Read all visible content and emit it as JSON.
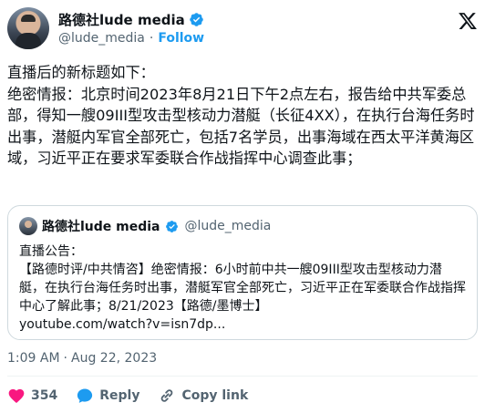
{
  "author": {
    "display_name": "路德社lude media",
    "handle": "@lude_media",
    "separator": "·",
    "follow_label": "Follow"
  },
  "tweet": {
    "text": "直播后的新标题如下：\n绝密情报：北京时间2023年8月21日下午2点左右，报告给中共军委总部，得知一艘09III型攻击型核动力潜艇（长征4XX），在执行台海任务时出事，潜艇内军官全部死亡，包括7名学员，出事海域在西太平洋黄海区域，习近平正在要求军委联合作战指挥中心调查此事；"
  },
  "quote": {
    "display_name": "路德社lude media",
    "handle": "@lude_media",
    "text": "直播公告：\n【路德时评/中共情咨】绝密情报：6小时前中共一艘09III型攻击型核动力潜艇，在执行台海任务时出事，潜艇军官全部死亡，习近平正在军委联合作战指挥中心了解此事；8/21/2023【路德/墨博士】\nyoutube.com/watch?v=isn7dp..."
  },
  "meta": {
    "time": "1:09 AM",
    "separator": "·",
    "date": "Aug 22, 2023"
  },
  "actions": {
    "like_count": "354",
    "reply_label": "Reply",
    "copy_link_label": "Copy link"
  },
  "colors": {
    "accent": "#1d9bf0",
    "like": "#f91880",
    "secondary_text": "#536471"
  },
  "icons": [
    "verified-badge-icon",
    "x-logo-icon",
    "heart-icon",
    "reply-bubble-icon",
    "link-icon"
  ]
}
